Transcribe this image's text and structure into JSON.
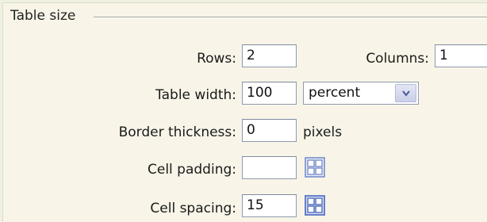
{
  "section": {
    "title": "Table size"
  },
  "fields": {
    "rows": {
      "label": "Rows:",
      "value": "2"
    },
    "columns": {
      "label": "Columns:",
      "value": "1"
    },
    "table_width": {
      "label": "Table width:",
      "value": "100",
      "unit_selected": "percent"
    },
    "border_thickness": {
      "label": "Border thickness:",
      "value": "0",
      "unit": "pixels"
    },
    "cell_padding": {
      "label": "Cell padding:",
      "value": ""
    },
    "cell_spacing": {
      "label": "Cell spacing:",
      "value": "15"
    }
  },
  "icons": {
    "select_arrow": "chevron-down-icon",
    "cell_padding_icon": "cell-grid-icon",
    "cell_spacing_icon": "cell-grid-icon"
  },
  "colors": {
    "panel_background": "#f8f5e8",
    "field_border": "#8e9ab0",
    "grid_icon": "#6f86c8"
  }
}
